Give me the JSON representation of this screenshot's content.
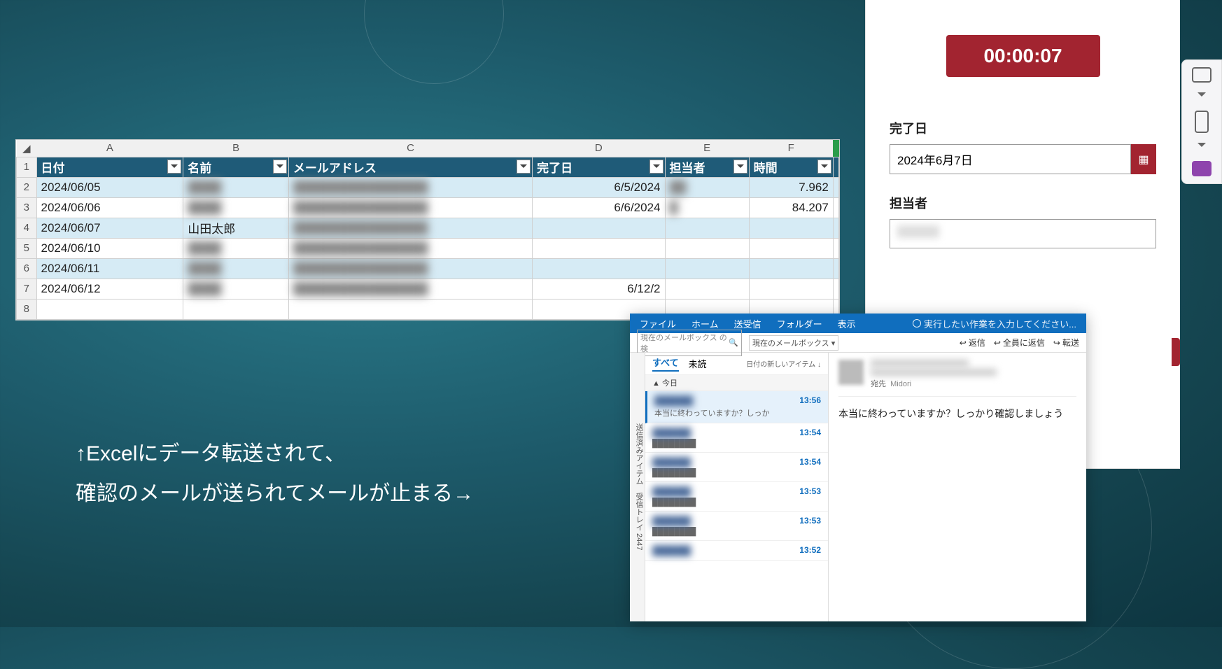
{
  "excel": {
    "col_letters": [
      "A",
      "B",
      "C",
      "D",
      "E",
      "F"
    ],
    "headers": {
      "a": "日付",
      "b": "名前",
      "c": "メールアドレス",
      "d": "完了日",
      "e": "担当者",
      "f": "時間"
    },
    "rows": [
      {
        "n": "2",
        "date": "2024/06/05",
        "name": "(blurred)",
        "done": "6/5/2024",
        "time": "7.962"
      },
      {
        "n": "3",
        "date": "2024/06/06",
        "name": "(blurred)",
        "done": "6/6/2024",
        "time": "84.207"
      },
      {
        "n": "4",
        "date": "2024/06/07",
        "name": "山田太郎",
        "done": "",
        "time": ""
      },
      {
        "n": "5",
        "date": "2024/06/10",
        "name": "(blurred)",
        "done": "",
        "time": ""
      },
      {
        "n": "6",
        "date": "2024/06/11",
        "name": "(blurred)",
        "done": "",
        "time": ""
      },
      {
        "n": "7",
        "date": "2024/06/12",
        "name": "(blurred)",
        "done": "6/12/2",
        "time": ""
      },
      {
        "n": "8",
        "date": "",
        "name": "",
        "done": "",
        "time": ""
      }
    ]
  },
  "caption": {
    "line1": "↑Excelにデータ転送されて、",
    "line2": "確認のメールが送られてメールが止まる→"
  },
  "panel": {
    "timer": "00:00:07",
    "done_label": "完了日",
    "done_value": "2024年6月7日",
    "assignee_label": "担当者"
  },
  "outlook": {
    "ribbon": {
      "file": "ファイル",
      "home": "ホーム",
      "sendrecv": "送受信",
      "folder": "フォルダー",
      "view": "表示",
      "tell": "実行したい作業を入力してください..."
    },
    "search_placeholder": "現在のメールボックス の検",
    "scope": "現在のメールボックス",
    "actions": {
      "reply": "返信",
      "replyall": "全員に返信",
      "forward": "転送"
    },
    "sidebar": "送信済みアイテム　受信トレイ 2447",
    "tabs": {
      "all": "すべて",
      "unread": "未読",
      "sort": "日付の新しいアイテム ↓"
    },
    "group_today": "▲ 今日",
    "items": [
      {
        "time": "13:56",
        "preview": "本当に終わっていますか？しっか"
      },
      {
        "time": "13:54",
        "preview": ""
      },
      {
        "time": "13:54",
        "preview": ""
      },
      {
        "time": "13:53",
        "preview": ""
      },
      {
        "time": "13:53",
        "preview": ""
      },
      {
        "time": "13:52",
        "preview": ""
      }
    ],
    "reading": {
      "to_label": "宛先",
      "to_value_hint": "Midori",
      "body": "本当に終わっていますか？しっかり確認しましょう"
    }
  }
}
